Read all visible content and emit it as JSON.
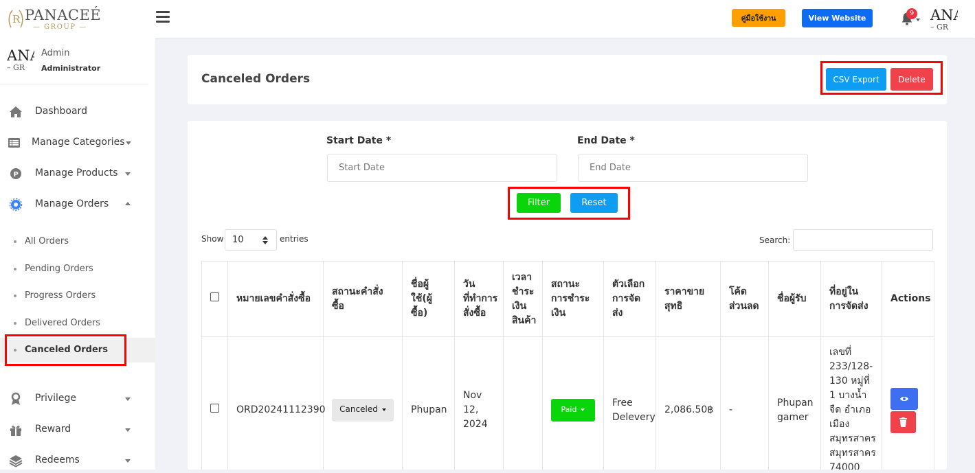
{
  "header": {
    "logo_main": "PANACEÉ",
    "logo_sub": "— GROUP —",
    "manual_label": "คู่มือใช้งาน",
    "view_website_label": "View Website",
    "notification_count": "9",
    "avatar_text": "ANA",
    "avatar_sub": "– GR"
  },
  "sidebar": {
    "user_name": "Admin",
    "user_role": "Administrator",
    "avatar_text": "ANA",
    "avatar_sub": "– GR",
    "menu": [
      {
        "label": "Dashboard"
      },
      {
        "label": "Manage Categories"
      },
      {
        "label": "Manage Products"
      },
      {
        "label": "Manage Orders"
      },
      {
        "label": "Privilege"
      },
      {
        "label": "Reward"
      },
      {
        "label": "Redeems"
      }
    ],
    "orders_sub": [
      {
        "label": "All Orders"
      },
      {
        "label": "Pending Orders"
      },
      {
        "label": "Progress Orders"
      },
      {
        "label": "Delivered Orders"
      },
      {
        "label": "Canceled Orders"
      }
    ]
  },
  "page": {
    "title": "Canceled Orders",
    "csv_export_label": "CSV Export",
    "delete_label": "Delete"
  },
  "filter": {
    "start_label": "Start Date *",
    "start_placeholder": "Start Date",
    "end_label": "End Date *",
    "end_placeholder": "End Date",
    "filter_label": "Filter",
    "reset_label": "Reset"
  },
  "table_controls": {
    "show_label": "Show",
    "entries_value": "10",
    "entries_label": "entries",
    "search_label": "Search:"
  },
  "table": {
    "headers": [
      "หมายเลขคำสั่งซื้อ",
      "สถานะคำสั่งซื้อ",
      "ชื่อผู้ใช้(ผู้ซื้อ)",
      "วันที่ทำการสั่งซื้อ",
      "เวลาชำระเงินสินค้า",
      "สถานะการชำระเงิน",
      "ตัวเลือกการจัดส่ง",
      "ราคาขายสุทธิ",
      "โค้ดส่วนลด",
      "ชื่อผู้รับ",
      "ที่อยู่ในการจัดส่ง",
      "Actions"
    ],
    "rows": [
      {
        "order_no": "ORD20241112390",
        "order_status": "Canceled",
        "buyer": "Phupan",
        "order_date": "Nov 12, 2024",
        "payment_time": "",
        "payment_status": "Paid",
        "shipping": "Free Delevery",
        "net_price": "2,086.50฿",
        "discount_code": "-",
        "recipient": "Phupan gamer",
        "address": "เลขที่ 233/128-130 หมู่ที่ 1 บางน้ำจืด อำเภอเมืองสมุทรสาคร สมุทรสาคร 74000"
      }
    ]
  }
}
